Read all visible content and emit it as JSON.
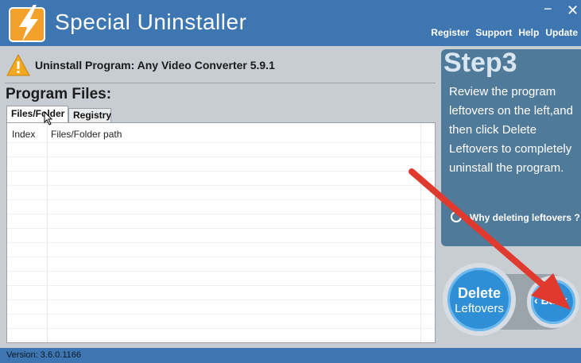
{
  "app": {
    "title": "Special Uninstaller",
    "window_controls": {
      "minimize": "−",
      "close": "✕"
    },
    "menu": [
      "Register",
      "Support",
      "Help",
      "Update"
    ]
  },
  "program": {
    "label": "Uninstall Program: Any Video Converter 5.9.1"
  },
  "files_panel": {
    "title": "Program Files:",
    "tabs": [
      {
        "label": "Files/Folder",
        "active": true
      },
      {
        "label": "Registry",
        "active": false
      }
    ],
    "columns": [
      "Index",
      "Files/Folder path"
    ],
    "rows": []
  },
  "step": {
    "title": "Step3",
    "description": "Review the program leftovers on the left,and then click Delete Leftovers to completely uninstall the program.",
    "why_link": "Why deleting leftovers ?"
  },
  "buttons": {
    "delete_line1": "Delete",
    "delete_line2": "Leftovers",
    "back": "Back"
  },
  "status": {
    "version": "Version: 3.6.0.1166"
  },
  "icons": {
    "logo": "lightning-logo-icon",
    "warning": "warning-icon",
    "why": "hand-pointer-icon",
    "back": "chevron-left-icon"
  },
  "colors": {
    "header": "#3d76b0",
    "step_panel": "#4f7a9a",
    "button": "#2f8fd6",
    "annotation_arrow": "#e03a2e"
  }
}
